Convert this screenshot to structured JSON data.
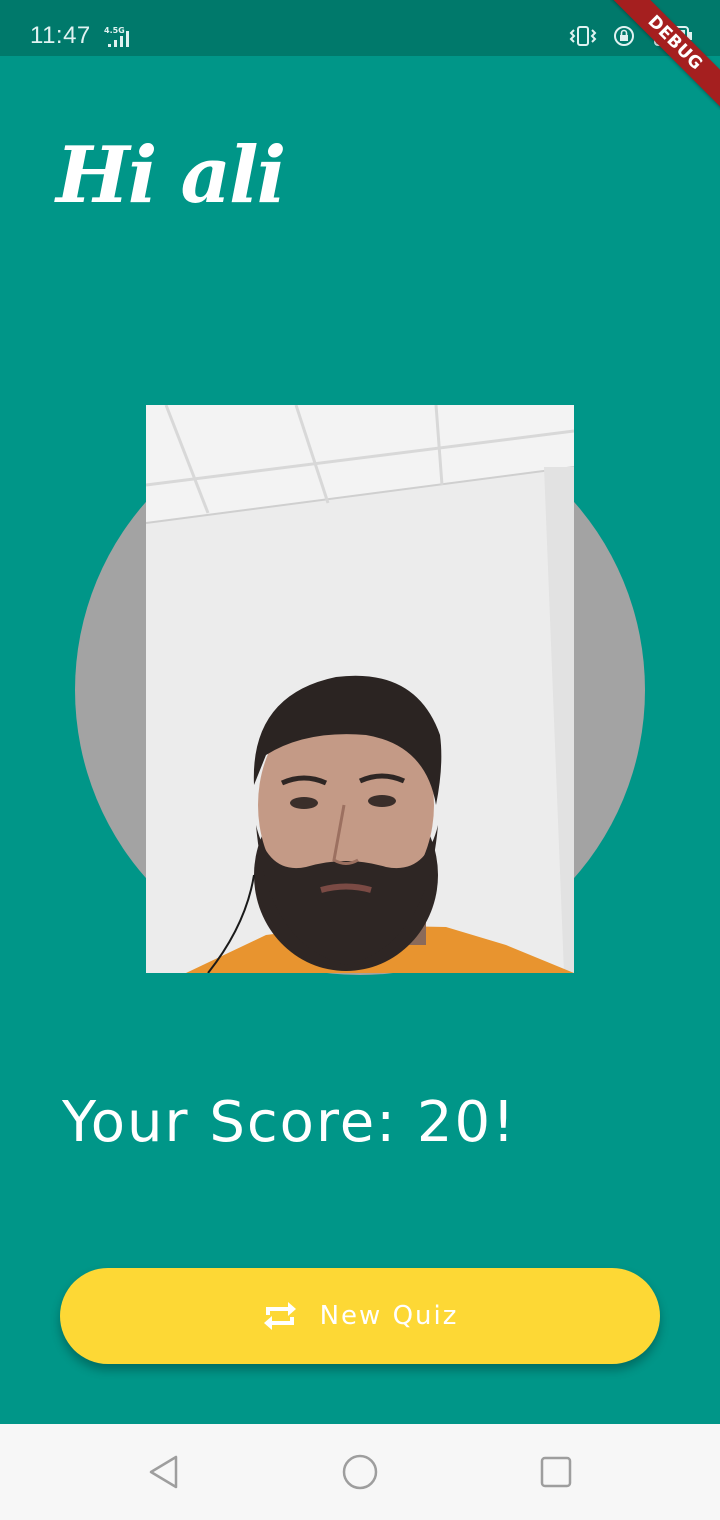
{
  "status_bar": {
    "time": "11:47",
    "network": "4.5G",
    "icons": [
      "vibrate-icon",
      "rotation-lock-icon",
      "battery-icon"
    ]
  },
  "debug_banner": "DEBUG",
  "greeting": "Hi ali",
  "score_text": "Your Score: 20!",
  "new_quiz_button": {
    "label": "New Quiz",
    "icon": "repeat-icon"
  },
  "nav_bar": {
    "buttons": [
      "back-icon",
      "home-icon",
      "recents-icon"
    ]
  },
  "colors": {
    "background": "#009688",
    "status_bar": "#00796b",
    "avatar_circle": "#a3a3a3",
    "button": "#fdd835",
    "debug": "#a51f1f"
  }
}
